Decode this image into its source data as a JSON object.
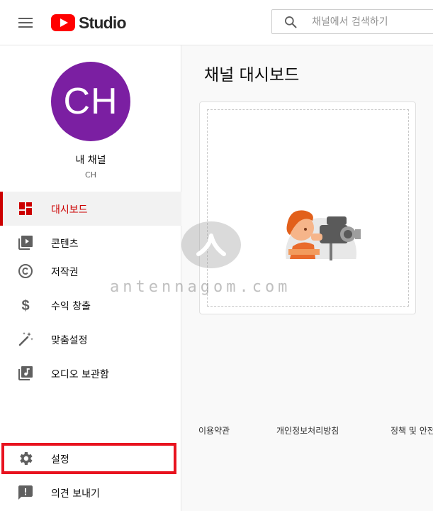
{
  "header": {
    "logo_text": "Studio",
    "search": {
      "placeholder": "채널에서 검색하기"
    }
  },
  "channel": {
    "avatar_initials": "CH",
    "name": "내 채널",
    "handle": "CH",
    "avatar_color": "#7b1fa2"
  },
  "sidebar": {
    "items": [
      {
        "label": "대시보드",
        "icon": "dashboard-icon",
        "active": true
      },
      {
        "label": "콘텐츠",
        "icon": "content-icon"
      },
      {
        "label": "저작권",
        "icon": "copyright-icon"
      },
      {
        "label": "수익 창출",
        "icon": "dollar-icon"
      },
      {
        "label": "맞춤설정",
        "icon": "magic-wand-icon"
      },
      {
        "label": "오디오 보관함",
        "icon": "audio-library-icon"
      },
      {
        "label": "설정",
        "icon": "gear-icon"
      },
      {
        "label": "의견 보내기",
        "icon": "feedback-icon"
      }
    ]
  },
  "main": {
    "title": "채널 대시보드"
  },
  "footer": {
    "links": [
      "이용약관",
      "개인정보처리방침",
      "정책 및 안전"
    ]
  },
  "watermark": {
    "text": "antennagom.com",
    "glyph": "ㅅ"
  },
  "colors": {
    "accent": "#cc0000",
    "youtube_red": "#ff0000",
    "highlight_box": "#e8131f"
  }
}
